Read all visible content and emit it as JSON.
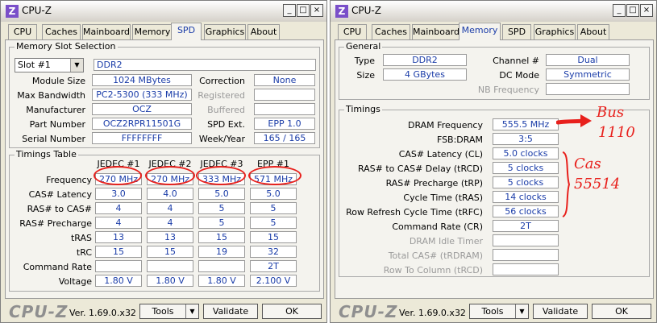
{
  "window_title": "CPU-Z",
  "title_buttons": [
    "_",
    "□",
    "×"
  ],
  "tabs": [
    "CPU",
    "Caches",
    "Mainboard",
    "Memory",
    "SPD",
    "Graphics",
    "About"
  ],
  "spd": {
    "slot_group": "Memory Slot Selection",
    "slot_select": "Slot #1",
    "mem_type": "DDR2",
    "labels": {
      "module_size": "Module Size",
      "max_bandwidth": "Max Bandwidth",
      "manufacturer": "Manufacturer",
      "part_number": "Part Number",
      "serial_number": "Serial Number",
      "correction": "Correction",
      "registered": "Registered",
      "buffered": "Buffered",
      "spd_ext": "SPD Ext.",
      "week_year": "Week/Year"
    },
    "values": {
      "module_size": "1024 MBytes",
      "max_bandwidth": "PC2-5300 (333 MHz)",
      "manufacturer": "OCZ",
      "part_number": "OCZ2RPR11501G",
      "serial_number": "FFFFFFFF",
      "correction": "None",
      "registered": "",
      "buffered": "",
      "spd_ext": "EPP 1.0",
      "week_year": "165 / 165"
    },
    "timings_group": "Timings Table",
    "columns": [
      "JEDEC #1",
      "JEDEC #2",
      "JEDEC #3",
      "EPP #1"
    ],
    "rows": [
      {
        "label": "Frequency",
        "values": [
          "270 MHz",
          "270 MHz",
          "333 MHz",
          "571 MHz"
        ]
      },
      {
        "label": "CAS# Latency",
        "values": [
          "3.0",
          "4.0",
          "5.0",
          "5.0"
        ]
      },
      {
        "label": "RAS# to CAS#",
        "values": [
          "4",
          "4",
          "5",
          "5"
        ]
      },
      {
        "label": "RAS# Precharge",
        "values": [
          "4",
          "4",
          "5",
          "5"
        ]
      },
      {
        "label": "tRAS",
        "values": [
          "13",
          "13",
          "15",
          "15"
        ]
      },
      {
        "label": "tRC",
        "values": [
          "15",
          "15",
          "19",
          "32"
        ]
      },
      {
        "label": "Command Rate",
        "values": [
          "",
          "",
          "",
          "2T"
        ]
      },
      {
        "label": "Voltage",
        "values": [
          "1.80 V",
          "1.80 V",
          "1.80 V",
          "2.100 V"
        ]
      }
    ]
  },
  "memory": {
    "general_group": "General",
    "labels": {
      "type": "Type",
      "size": "Size",
      "channel": "Channel #",
      "dc_mode": "DC Mode",
      "nb_freq": "NB Frequency"
    },
    "values": {
      "type": "DDR2",
      "size": "4 GBytes",
      "channel": "Dual",
      "dc_mode": "Symmetric",
      "nb_freq": ""
    },
    "timings_group": "Timings",
    "timings": [
      {
        "label": "DRAM Frequency",
        "value": "555.5 MHz"
      },
      {
        "label": "FSB:DRAM",
        "value": "3:5"
      },
      {
        "label": "CAS# Latency (CL)",
        "value": "5.0 clocks"
      },
      {
        "label": "RAS# to CAS# Delay (tRCD)",
        "value": "5 clocks"
      },
      {
        "label": "RAS# Precharge (tRP)",
        "value": "5 clocks"
      },
      {
        "label": "Cycle Time (tRAS)",
        "value": "14 clocks"
      },
      {
        "label": "Row Refresh Cycle Time (tRFC)",
        "value": "56 clocks"
      },
      {
        "label": "Command Rate (CR)",
        "value": "2T"
      }
    ],
    "disabled_timings": [
      {
        "label": "DRAM Idle Timer",
        "value": ""
      },
      {
        "label": "Total CAS# (tRDRAM)",
        "value": ""
      },
      {
        "label": "Row To Column (tRCD)",
        "value": ""
      }
    ]
  },
  "footer": {
    "logo": "CPU-Z",
    "version": "Ver. 1.69.0.x32",
    "tools": "Tools",
    "validate": "Validate",
    "ok": "OK"
  },
  "annotations": {
    "bus": "Bus",
    "bus_value": "1110",
    "cas": "Cas",
    "cas_value": "55514"
  },
  "colors": {
    "value_text": "#1a3ca8",
    "annotation": "#e8201c",
    "logo_gray": "#8f8f8f"
  }
}
